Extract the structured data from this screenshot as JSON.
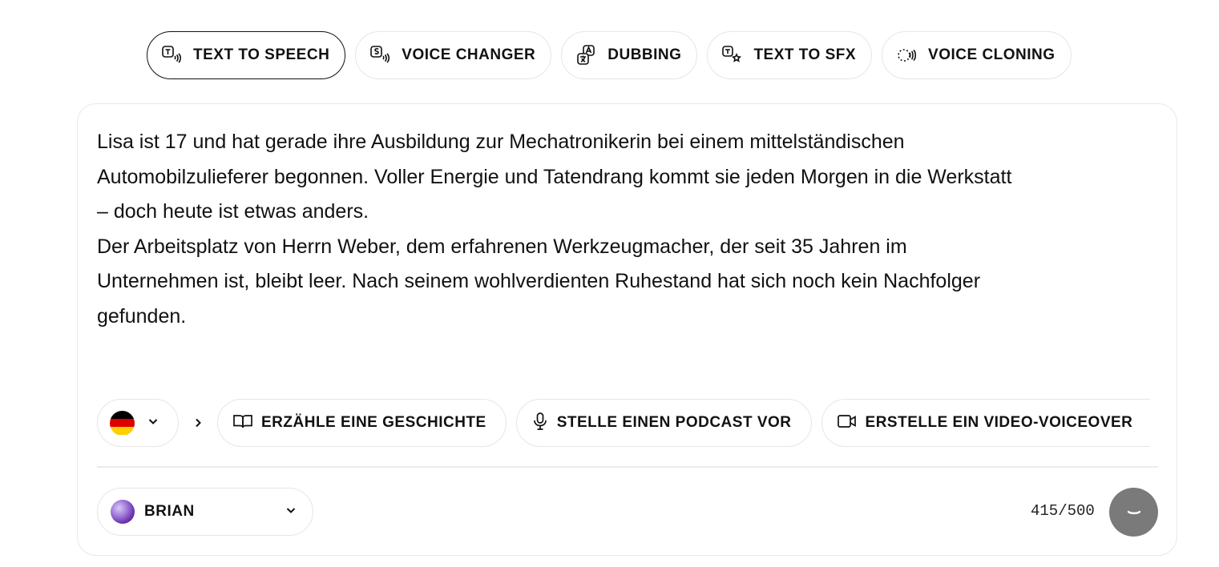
{
  "tabs": [
    {
      "label": "TEXT TO SPEECH",
      "icon": "text-to-speech-icon",
      "active": true
    },
    {
      "label": "VOICE CHANGER",
      "icon": "voice-changer-icon",
      "active": false
    },
    {
      "label": "DUBBING",
      "icon": "dubbing-icon",
      "active": false
    },
    {
      "label": "TEXT TO SFX",
      "icon": "text-to-sfx-icon",
      "active": false
    },
    {
      "label": "VOICE CLONING",
      "icon": "voice-cloning-icon",
      "active": false
    }
  ],
  "editor": {
    "text": "Lisa ist 17 und hat gerade ihre Ausbildung zur Mechatronikerin bei einem mittelständischen\nAutomobilzulieferer begonnen. Voller Energie und Tatendrang kommt sie jeden Morgen in die Werkstatt\n– doch heute ist etwas anders.\nDer Arbeitsplatz von Herrn Weber, dem erfahrenen Werkzeugmacher, der seit 35 Jahren im\nUnternehmen ist, bleibt leer. Nach seinem wohlverdienten Ruhestand hat sich noch kein Nachfolger\ngefunden."
  },
  "language": {
    "flag": "german-flag-icon",
    "colors": [
      "#000000",
      "#dd0000",
      "#ffce00"
    ]
  },
  "suggestions": [
    {
      "label": "ERZÄHLE EINE GESCHICHTE",
      "icon": "book-icon"
    },
    {
      "label": "STELLE EINEN PODCAST VOR",
      "icon": "microphone-icon"
    },
    {
      "label": "ERSTELLE EIN VIDEO-VOICEOVER",
      "icon": "video-camera-icon"
    }
  ],
  "voice": {
    "name": "BRIAN"
  },
  "counter": "415/500",
  "colors": {
    "play_button": "#7a7a7a",
    "border": "#e6e6e6",
    "active_border": "#111111"
  }
}
